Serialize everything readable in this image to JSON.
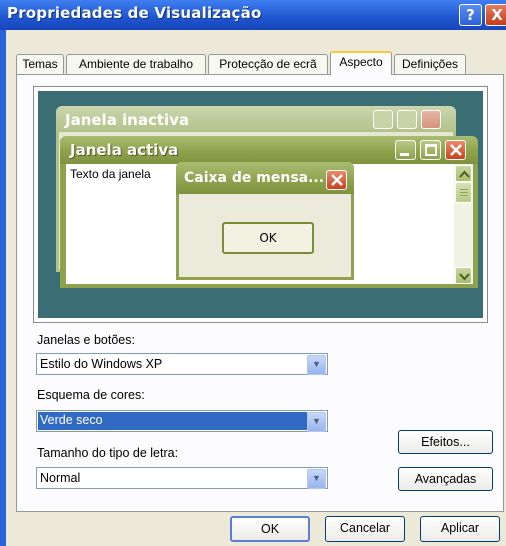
{
  "window": {
    "title": "Propriedades de Visualização",
    "help_glyph": "?",
    "close_glyph": "X"
  },
  "tabs": [
    {
      "label": "Temas",
      "active": false
    },
    {
      "label": "Ambiente de trabalho",
      "active": false
    },
    {
      "label": "Protecção de ecrã",
      "active": false
    },
    {
      "label": "Aspecto",
      "active": true
    },
    {
      "label": "Definições",
      "active": false
    }
  ],
  "preview": {
    "inactive_title": "Janela inactiva",
    "active_title": "Janela activa",
    "window_text": "Texto da janela",
    "message_title": "Caixa de mensa...",
    "message_ok": "OK"
  },
  "fields": {
    "windows_buttons_label": "Janelas e botões:",
    "windows_buttons_value": "Estilo do Windows XP",
    "color_scheme_label": "Esquema de cores:",
    "color_scheme_value": "Verde seco",
    "font_size_label": "Tamanho do tipo de letra:",
    "font_size_value": "Normal"
  },
  "buttons": {
    "effects": "Efeitos...",
    "advanced": "Avançadas",
    "ok": "OK",
    "cancel": "Cancelar",
    "apply": "Aplicar"
  },
  "colors": {
    "xp_blue": "#2b62d6",
    "olive_title": "#8ea24d",
    "desktop_teal": "#3a6e74",
    "selection_blue": "#316ac5"
  }
}
